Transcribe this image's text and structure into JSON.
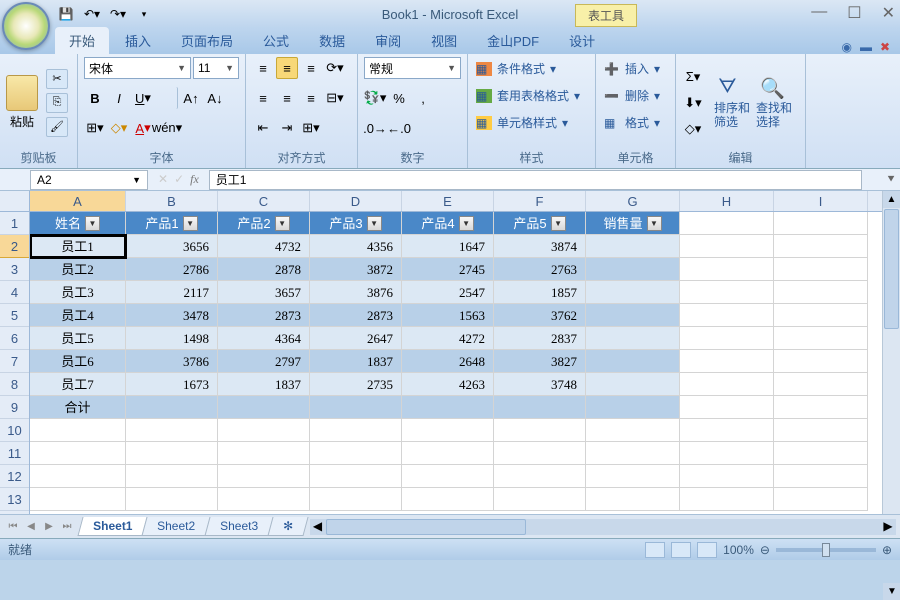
{
  "title": "Book1 - Microsoft Excel",
  "context_tab": "表工具",
  "tabs": [
    "开始",
    "插入",
    "页面布局",
    "公式",
    "数据",
    "审阅",
    "视图",
    "金山PDF",
    "设计"
  ],
  "active_tab": "开始",
  "groups": {
    "clipboard": "剪贴板",
    "paste": "粘贴",
    "font": "字体",
    "alignment": "对齐方式",
    "number": "数字",
    "styles": "样式",
    "cells": "单元格",
    "editing": "编辑"
  },
  "font": {
    "name": "宋体",
    "size": "11"
  },
  "number_format": "常规",
  "styles_items": [
    "条件格式",
    "套用表格格式",
    "单元格样式"
  ],
  "cells_items": [
    "插入",
    "删除",
    "格式"
  ],
  "edit_items": {
    "sort": "排序和\n筛选",
    "find": "查找和\n选择"
  },
  "namebox": "A2",
  "formula": "员工1",
  "columns": [
    "A",
    "B",
    "C",
    "D",
    "E",
    "F",
    "G",
    "H",
    "I"
  ],
  "headers": [
    "姓名",
    "产品1",
    "产品2",
    "产品3",
    "产品4",
    "产品5",
    "销售量"
  ],
  "chart_data": {
    "type": "table",
    "columns": [
      "姓名",
      "产品1",
      "产品2",
      "产品3",
      "产品4",
      "产品5",
      "销售量"
    ],
    "rows": [
      [
        "员工1",
        3656,
        4732,
        4356,
        1647,
        3874,
        null
      ],
      [
        "员工2",
        2786,
        2878,
        3872,
        2745,
        2763,
        null
      ],
      [
        "员工3",
        2117,
        3657,
        3876,
        2547,
        1857,
        null
      ],
      [
        "员工4",
        3478,
        2873,
        2873,
        1563,
        3762,
        null
      ],
      [
        "员工5",
        1498,
        4364,
        2647,
        4272,
        2837,
        null
      ],
      [
        "员工6",
        3786,
        2797,
        1837,
        2648,
        3827,
        null
      ],
      [
        "员工7",
        1673,
        1837,
        2735,
        4263,
        3748,
        null
      ],
      [
        "合计",
        null,
        null,
        null,
        null,
        null,
        null
      ]
    ]
  },
  "sheets": [
    "Sheet1",
    "Sheet2",
    "Sheet3"
  ],
  "active_sheet": "Sheet1",
  "status": "就绪",
  "zoom": "100%"
}
